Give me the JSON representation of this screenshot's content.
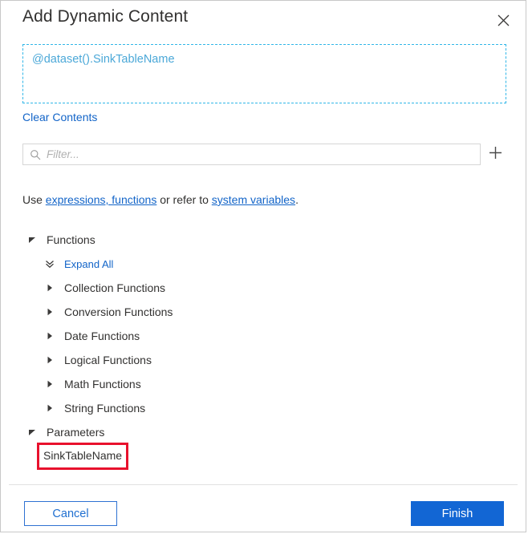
{
  "dialog": {
    "title": "Add Dynamic Content",
    "close_icon": "close-icon"
  },
  "expression": {
    "value": "@dataset().SinkTableName",
    "clear_label": "Clear Contents",
    "border_color": "#30b6e8",
    "text_color": "#4ba8d8"
  },
  "filter": {
    "value": "",
    "placeholder": "Filter...",
    "search_icon": "search-icon",
    "add_icon": "plus-icon"
  },
  "help": {
    "prefix": "Use ",
    "link1": "expressions, functions",
    "middle": " or refer to ",
    "link2": "system variables",
    "suffix": ".",
    "link_color": "#1264c8"
  },
  "tree": {
    "functions": {
      "label": "Functions",
      "expanded": true,
      "expand_all_label": "Expand All",
      "expand_all_icon": "double-chevron-down-icon",
      "children": [
        {
          "label": "Collection Functions",
          "icon": "chevron-right-icon"
        },
        {
          "label": "Conversion Functions",
          "icon": "chevron-right-icon"
        },
        {
          "label": "Date Functions",
          "icon": "chevron-right-icon"
        },
        {
          "label": "Logical Functions",
          "icon": "chevron-right-icon"
        },
        {
          "label": "Math Functions",
          "icon": "chevron-right-icon"
        },
        {
          "label": "String Functions",
          "icon": "chevron-right-icon"
        }
      ]
    },
    "parameters": {
      "label": "Parameters",
      "expanded": true,
      "items": [
        {
          "label": "SinkTableName",
          "highlighted": true
        }
      ]
    }
  },
  "annotation": {
    "color": "#e8112d"
  },
  "footer": {
    "cancel_label": "Cancel",
    "finish_label": "Finish",
    "primary_color": "#1266d4"
  }
}
